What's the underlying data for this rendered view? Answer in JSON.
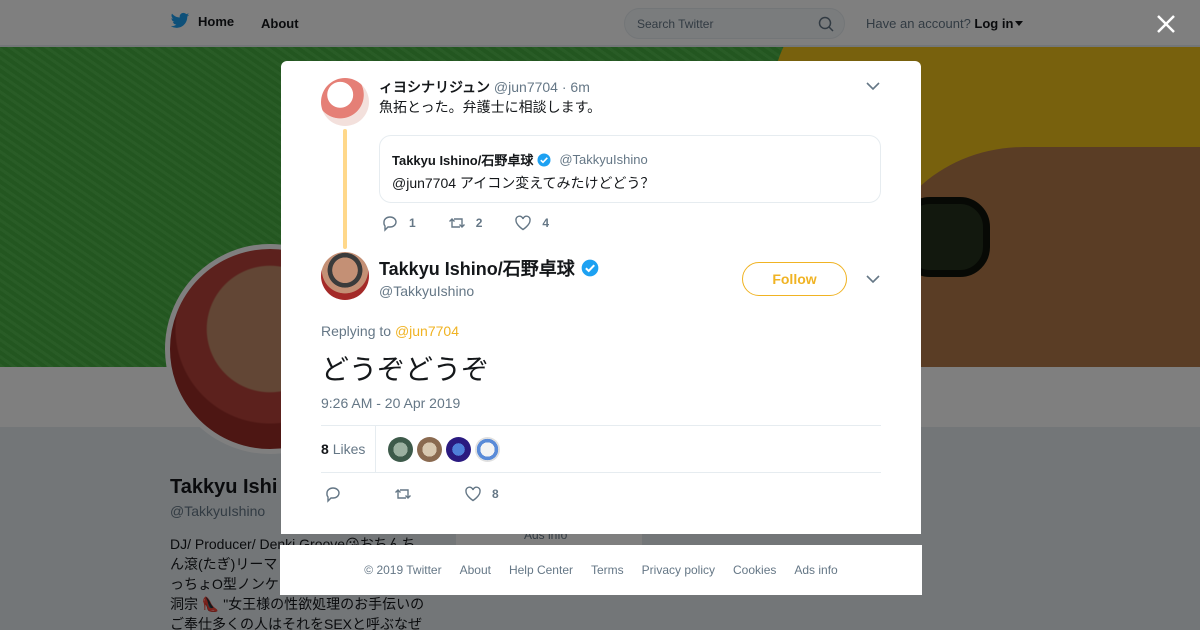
{
  "nav": {
    "home_label": "Home",
    "about_label": "About",
    "search_placeholder": "Search Twitter",
    "account_prompt": "Have an account?",
    "login_label": "Log in"
  },
  "profile": {
    "name": "Takkyu Ishi",
    "handle": "@TakkyuIshino",
    "bio_lines": [
      "DJ/ Producer/ Denki Groove😘おちんち",
      "ん滾(たぎ)リーマ",
      "っちょO型ノンケ",
      "洞宗 👠 \"女王様の性欲処理のお手伝いの",
      "ご奉仕多くの人はそれをSEXと呼ぶなぜ"
    ],
    "ads_info": "Ads info"
  },
  "colors": {
    "accent": "#f0b323",
    "twitter_blue": "#1da1f2",
    "banner_green": "#49b444"
  },
  "parent_tweet": {
    "name": "ィヨシナリジュン",
    "handle": "@jun7704",
    "time": "· 6m",
    "text": "魚拓とった。弁護士に相談します。",
    "quote": {
      "name": "Takkyu Ishino/石野卓球",
      "handle": "@TakkyuIshino",
      "text": "@jun7704 アイコン変えてみたけどどう？"
    },
    "reply_count": "1",
    "retweet_count": "2",
    "like_count": "4"
  },
  "main_tweet": {
    "name": "Takkyu Ishino/石野卓球",
    "handle": "@TakkyuIshino",
    "follow_label": "Follow",
    "replying_prefix": "Replying to",
    "replying_to": "@jun7704",
    "text": "どうぞどうぞ",
    "timestamp": "9:26 AM - 20 Apr 2019",
    "likes_number": "8",
    "likes_word": "Likes",
    "like_count": "8"
  },
  "footer": {
    "copyright": "© 2019 Twitter",
    "about": "About",
    "help": "Help Center",
    "terms": "Terms",
    "privacy": "Privacy policy",
    "cookies": "Cookies",
    "ads": "Ads info"
  }
}
